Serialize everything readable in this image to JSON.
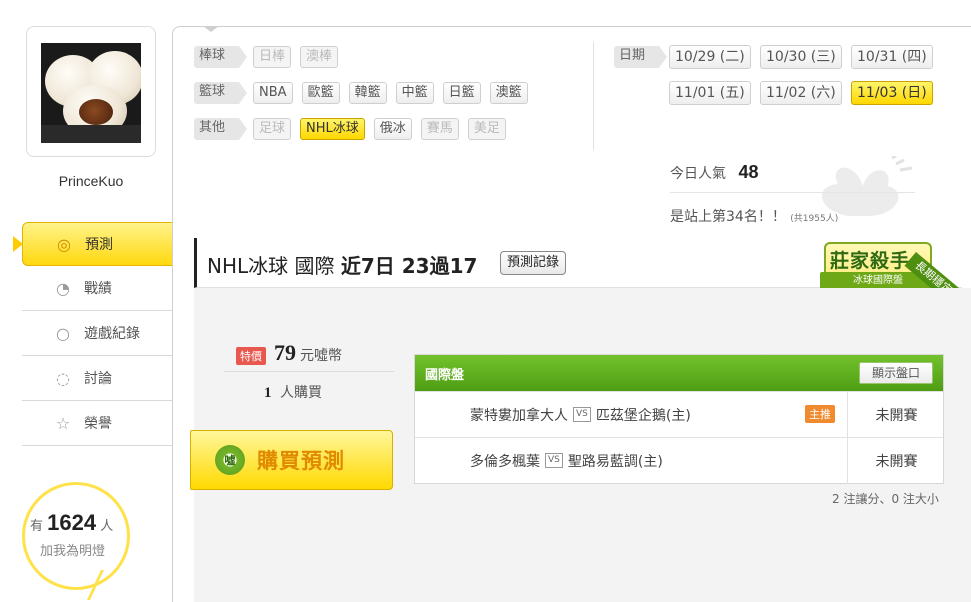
{
  "user": {
    "name": "PrinceKuo"
  },
  "side_nav": [
    {
      "label": "預測",
      "icon": "target-icon",
      "glyph": "◎"
    },
    {
      "label": "戰績",
      "icon": "chart-bubble-icon",
      "glyph": "◔"
    },
    {
      "label": "遊戲紀錄",
      "icon": "ring-icon",
      "glyph": "○"
    },
    {
      "label": "討論",
      "icon": "chat-icon",
      "glyph": "◌"
    },
    {
      "label": "榮譽",
      "icon": "medal-icon",
      "glyph": "☆"
    }
  ],
  "fans": {
    "prefix": "有",
    "count": "1624",
    "suffix": "人",
    "caption": "加我為明燈"
  },
  "categories": [
    {
      "label": "棒球",
      "items": [
        {
          "label": "日棒",
          "state": "disabled"
        },
        {
          "label": "澳棒",
          "state": "disabled"
        }
      ]
    },
    {
      "label": "籃球",
      "items": [
        {
          "label": "NBA",
          "state": "normal"
        },
        {
          "label": "歐籃",
          "state": "normal"
        },
        {
          "label": "韓籃",
          "state": "normal"
        },
        {
          "label": "中籃",
          "state": "normal"
        },
        {
          "label": "日籃",
          "state": "normal"
        },
        {
          "label": "澳籃",
          "state": "normal"
        }
      ]
    },
    {
      "label": "其他",
      "items": [
        {
          "label": "足球",
          "state": "disabled"
        },
        {
          "label": "NHL冰球",
          "state": "selected"
        },
        {
          "label": "俄冰",
          "state": "normal"
        },
        {
          "label": "賽馬",
          "state": "disabled"
        },
        {
          "label": "美足",
          "state": "disabled"
        }
      ]
    }
  ],
  "dates": {
    "label": "日期",
    "items": [
      {
        "label": "10/29 (二)",
        "state": "normal"
      },
      {
        "label": "10/30 (三)",
        "state": "normal"
      },
      {
        "label": "10/31 (四)",
        "state": "normal"
      },
      {
        "label": "11/01 (五)",
        "state": "normal"
      },
      {
        "label": "11/02 (六)",
        "state": "normal"
      },
      {
        "label": "11/03 (日)",
        "state": "selected"
      }
    ]
  },
  "popularity": {
    "label": "今日人氣",
    "value": "48"
  },
  "rank": {
    "text": "是站上第34名！！",
    "note": "(共1955人)"
  },
  "prediction": {
    "league": "NHL冰球 國際",
    "record": "近7日 23過17",
    "record_button": "預測記錄"
  },
  "badge": {
    "title": "莊家殺手",
    "subtitle": "冰球國際盤",
    "sash": "長期穩定"
  },
  "price": {
    "sale_label": "特價",
    "amount": "79",
    "unit": "元噓幣"
  },
  "buyers": {
    "count": "1",
    "label": "人購買"
  },
  "buy_button": {
    "label": "購買預測",
    "icon_text": "噓"
  },
  "market": {
    "title": "國際盤",
    "show_button": "顯示盤口",
    "vs_label": "VS",
    "matches": [
      {
        "away": "蒙特婁加拿大人",
        "home": "匹茲堡企鵝(主)",
        "tag": "主推",
        "status": "未開賽"
      },
      {
        "away": "多倫多楓葉",
        "home": "聖路易藍調(主)",
        "tag": "",
        "status": "未開賽"
      }
    ],
    "summary": "2 注讓分、0 注大小"
  },
  "colors": {
    "accent_yellow": "#ffd700",
    "green": "#5aa81a",
    "sale_red": "#e9584f"
  }
}
